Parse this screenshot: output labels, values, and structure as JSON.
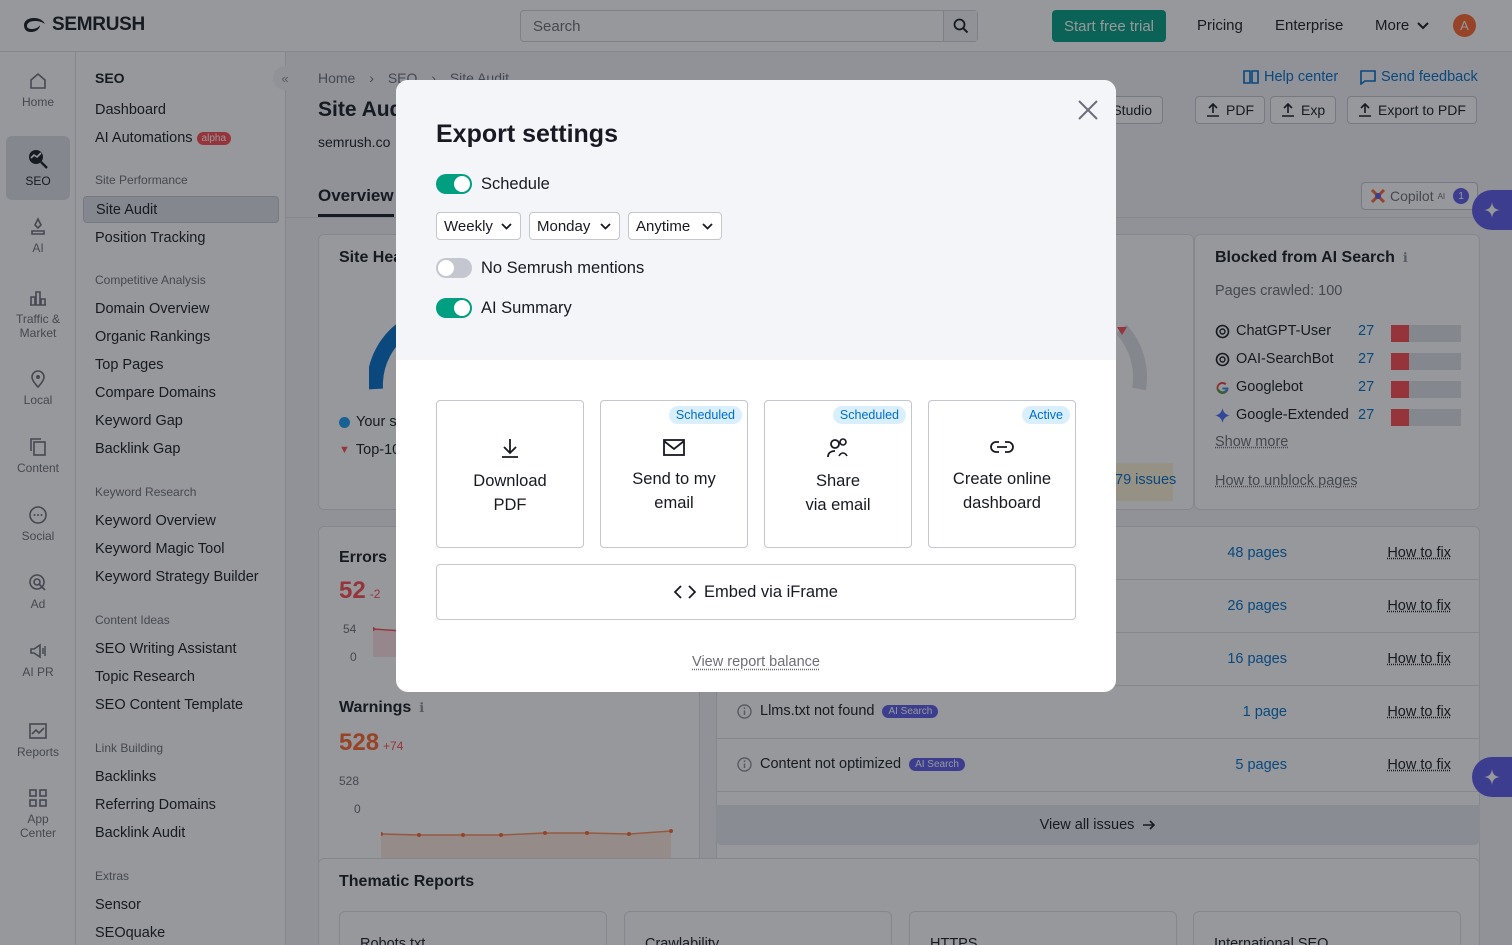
{
  "topbar": {
    "logo": "SEMRUSH",
    "search_placeholder": "Search",
    "start_trial": "Start free trial",
    "pricing": "Pricing",
    "enterprise": "Enterprise",
    "more": "More",
    "avatar_letter": "A"
  },
  "rail": [
    {
      "label": "Home",
      "icon": "home-icon"
    },
    {
      "label": "SEO",
      "icon": "seo-icon"
    },
    {
      "label": "AI",
      "icon": "ai-icon"
    },
    {
      "label": "Traffic & Market",
      "icon": "bar-chart-icon"
    },
    {
      "label": "Local",
      "icon": "pin-icon"
    },
    {
      "label": "Content",
      "icon": "content-icon"
    },
    {
      "label": "Social",
      "icon": "chat-icon"
    },
    {
      "label": "Ad",
      "icon": "target-icon"
    },
    {
      "label": "AI PR",
      "icon": "megaphone-icon"
    },
    {
      "label": "Reports",
      "icon": "reports-icon"
    },
    {
      "label": "App Center",
      "icon": "grid-icon"
    }
  ],
  "sidebar": {
    "title": "SEO",
    "dashboard": "Dashboard",
    "ai_automations": "AI Automations",
    "alpha": "alpha",
    "site_performance": "Site Performance",
    "site_audit": "Site Audit",
    "position_tracking": "Position Tracking",
    "competitive_analysis": "Competitive Analysis",
    "domain_overview": "Domain Overview",
    "organic_rankings": "Organic Rankings",
    "top_pages": "Top Pages",
    "compare_domains": "Compare Domains",
    "keyword_gap": "Keyword Gap",
    "backlink_gap": "Backlink Gap",
    "keyword_research": "Keyword Research",
    "keyword_overview": "Keyword Overview",
    "keyword_magic_tool": "Keyword Magic Tool",
    "keyword_strategy_builder": "Keyword Strategy Builder",
    "content_ideas": "Content Ideas",
    "seo_writing_assistant": "SEO Writing Assistant",
    "topic_research": "Topic Research",
    "seo_content_template": "SEO Content Template",
    "link_building": "Link Building",
    "backlinks": "Backlinks",
    "referring_domains": "Referring Domains",
    "backlink_audit": "Backlink Audit",
    "extras": "Extras",
    "sensor": "Sensor",
    "seoquake": "SEOquake"
  },
  "main": {
    "crumb_home": "Home",
    "crumb_seo": "SEO",
    "crumb_site_audit": "Site Audit",
    "help_center": "Help center",
    "send_feedback": "Send feedback",
    "page_title": "Site Aud",
    "domain": "semrush.co",
    "looker_studio": "er Studio",
    "pdf": "PDF",
    "exp": "Exp",
    "export_pdf": "Export to PDF",
    "tab_overview": "Overview",
    "copilot": "Copilot",
    "copilot_sup": "AI",
    "copilot_count": "1",
    "site_health": "Site Hea",
    "your_site": "Your s",
    "top10": "Top-10",
    "issues_link": "79 issues",
    "blocked_title": "Blocked from AI Search",
    "pages_crawled": "Pages crawled: 100",
    "bots": [
      {
        "name": "ChatGPT-User",
        "count": "27"
      },
      {
        "name": "OAI-SearchBot",
        "count": "27"
      },
      {
        "name": "Googlebot",
        "count": "27"
      },
      {
        "name": "Google-Extended",
        "count": "27"
      }
    ],
    "show_more": "Show more",
    "how_unblock": "How to unblock pages",
    "errors_title": "Errors",
    "errors_value": "52",
    "errors_delta": "-2",
    "errors_ymax": "54",
    "errors_ymin": "0",
    "warnings_title": "Warnings",
    "warnings_value": "528",
    "warnings_delta": "+74",
    "warnings_ymax": "528",
    "warnings_ymin": "0",
    "issue_rows": [
      {
        "label": "",
        "badge": "",
        "pages": "48 pages",
        "fix": "How to fix"
      },
      {
        "label": "",
        "badge": "",
        "pages": "26 pages",
        "fix": "How to fix"
      },
      {
        "label": "",
        "badge": "",
        "pages": "16 pages",
        "fix": "How to fix"
      },
      {
        "label": "Llms.txt not found",
        "badge": "AI Search",
        "pages": "1 page",
        "fix": "How to fix"
      },
      {
        "label": "Content not optimized",
        "badge": "AI Search",
        "pages": "5 pages",
        "fix": "How to fix"
      }
    ],
    "view_all_issues": "View all issues",
    "thematic_title": "Thematic Reports",
    "thematic": [
      "Robots.txt",
      "Crawlability",
      "HTTPS",
      "International SEO"
    ]
  },
  "modal": {
    "title": "Export settings",
    "schedule_label": "Schedule",
    "schedule_on": true,
    "frequency": "Weekly",
    "day": "Monday",
    "time": "Anytime",
    "no_mentions_label": "No Semrush mentions",
    "no_mentions_on": false,
    "ai_summary_label": "AI Summary",
    "ai_summary_on": true,
    "options": [
      {
        "line1": "Download",
        "line2": "PDF",
        "badge": "",
        "icon": "download-icon"
      },
      {
        "line1": "Send to my",
        "line2": "email",
        "badge": "Scheduled",
        "icon": "mail-icon"
      },
      {
        "line1": "Share",
        "line2": "via email",
        "badge": "Scheduled",
        "icon": "share-users-icon"
      },
      {
        "line1": "Create online",
        "line2": "dashboard",
        "badge": "Active",
        "icon": "link-icon"
      }
    ],
    "embed": "Embed via iFrame",
    "view_balance": "View report balance"
  },
  "colors": {
    "accent_green": "#009f81",
    "link_blue": "#006dca",
    "error_red": "#ff4953",
    "ai_purple": "#5c5ae8"
  }
}
